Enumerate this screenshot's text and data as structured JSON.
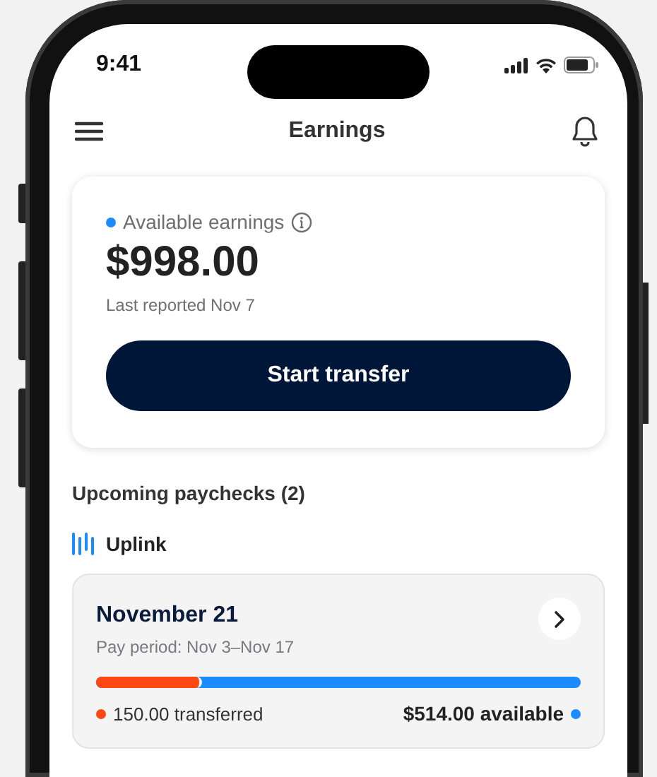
{
  "status_bar": {
    "time": "9:41"
  },
  "header": {
    "title": "Earnings"
  },
  "earnings": {
    "label": "Available earnings",
    "amount": "$998.00",
    "note": "Last reported Nov 7",
    "button": "Start transfer"
  },
  "section": {
    "title": "Upcoming paychecks (2)"
  },
  "provider": {
    "name": "Uplink"
  },
  "paychecks": [
    {
      "date": "November 21",
      "pay_period": "Pay period: Nov 3–Nov 17",
      "level": 0.22,
      "segments": [
        {
          "kind": "transferred",
          "text": "150.00 transferred",
          "color": "#ff4713"
        },
        {
          "kind": "available",
          "text": "$514.00 available",
          "color": "#1a8cff"
        }
      ]
    }
  ]
}
